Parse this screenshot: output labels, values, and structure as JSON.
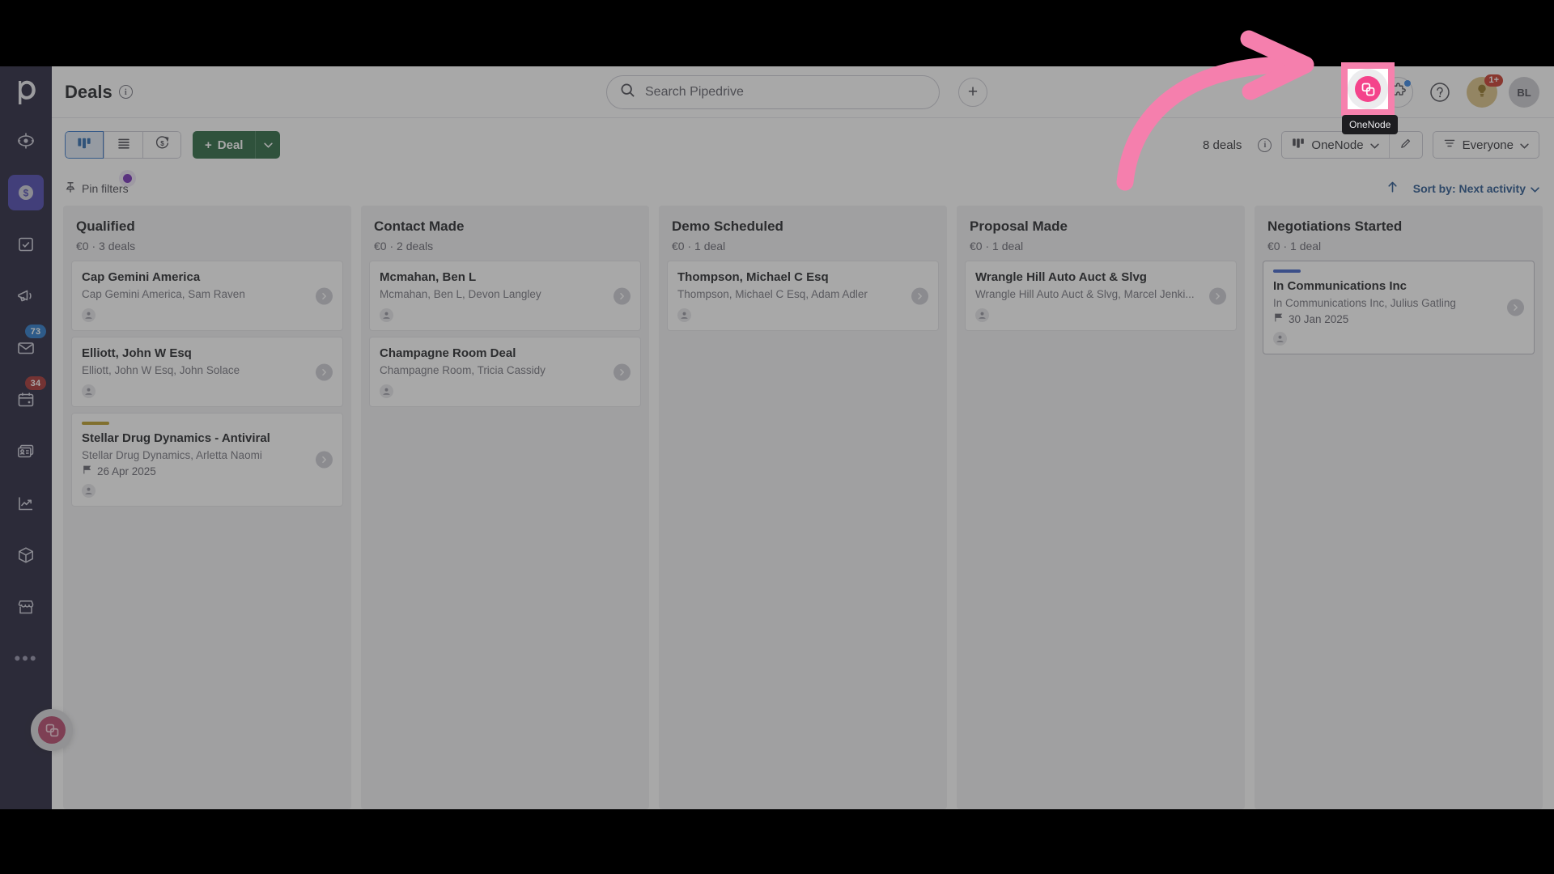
{
  "app": {
    "brand": "Pipedrive",
    "page_title": "Deals",
    "logo_icon": "pipedrive-logo-icon",
    "info_icon": "info-icon"
  },
  "sidebar": {
    "items": [
      {
        "name": "leads",
        "icon": "target-icon",
        "label": "Leads",
        "active": false,
        "badge": null
      },
      {
        "name": "deals",
        "icon": "dollar-coin-icon",
        "label": "Deals",
        "active": true,
        "badge": null
      },
      {
        "name": "activities",
        "icon": "checkbox-icon",
        "label": "Activities",
        "active": false,
        "badge": null
      },
      {
        "name": "campaigns",
        "icon": "megaphone-icon",
        "label": "Campaigns",
        "active": false,
        "badge": null
      },
      {
        "name": "mail",
        "icon": "envelope-icon",
        "label": "Mail",
        "active": false,
        "badge": "73",
        "badge_color": "#1a6fc4"
      },
      {
        "name": "calendar",
        "icon": "calendar-icon",
        "label": "Calendar",
        "active": false,
        "badge": "34",
        "badge_color": "#9e2222"
      },
      {
        "name": "contacts",
        "icon": "contact-card-icon",
        "label": "Contacts",
        "active": false,
        "badge": null
      },
      {
        "name": "insights",
        "icon": "line-chart-icon",
        "label": "Insights",
        "active": false,
        "badge": null
      },
      {
        "name": "products",
        "icon": "box-icon",
        "label": "Products",
        "active": false,
        "badge": null
      },
      {
        "name": "marketplace",
        "icon": "storefront-icon",
        "label": "Marketplace",
        "active": false,
        "badge": null
      },
      {
        "name": "more",
        "icon": "ellipsis-icon",
        "label": "More",
        "active": false,
        "badge": null
      }
    ],
    "more_glyph": "•••"
  },
  "search": {
    "placeholder": "Search Pipedrive",
    "value": "",
    "icon": "search-icon"
  },
  "topbar": {
    "add_label": "+",
    "onenode_icon": "onenode-app-icon",
    "onenode_tooltip": "OneNode",
    "apps_icon": "puzzle-piece-icon",
    "apps_has_update_dot": true,
    "help_icon": "question-mark-icon",
    "help_label": "?",
    "bulb_icon": "lightbulb-icon",
    "bulb_badge": "1+",
    "avatar_initials": "BL"
  },
  "actionbar": {
    "views": [
      {
        "name": "pipeline-view",
        "icon": "kanban-icon",
        "active": true
      },
      {
        "name": "list-view",
        "icon": "list-icon",
        "active": false
      },
      {
        "name": "forecast-view",
        "icon": "forecast-icon",
        "active": false
      }
    ],
    "deal_button": "Deal",
    "deal_button_plus": "+",
    "deal_caret_icon": "chevron-down-icon",
    "deals_count": "8 deals",
    "deals_info_icon": "info-icon",
    "pipeline_icon": "kanban-icon",
    "pipeline_name": "OneNode",
    "pipeline_caret_icon": "chevron-down-icon",
    "edit_icon": "pencil-icon",
    "filter_icon": "filter-icon",
    "filter_label": "Everyone",
    "filter_caret_icon": "chevron-down-icon"
  },
  "filterrow": {
    "pin_icon": "pin-icon",
    "pin_label": "Pin filters",
    "has_indicator_dot": true,
    "indicator_color": "#6b1fb1",
    "sort_arrow_icon": "arrow-up-icon",
    "sort_label": "Sort by: Next activity",
    "sort_caret_icon": "chevron-down-icon",
    "sort_color": "#1a4a86"
  },
  "board": {
    "columns": [
      {
        "title": "Qualified",
        "summary": "€0 · 3 deals",
        "cards": [
          {
            "title": "Cap Gemini America",
            "subtitle": "Cap Gemini America, Sam Raven",
            "date": null,
            "bar_color": null,
            "person_icon": "person-icon",
            "chevron_icon": "chevron-right-icon"
          },
          {
            "title": "Elliott, John W Esq",
            "subtitle": "Elliott, John W Esq, John Solace",
            "date": null,
            "bar_color": null,
            "person_icon": "person-icon",
            "chevron_icon": "chevron-right-icon"
          },
          {
            "title": "Stellar Drug Dynamics - Antiviral",
            "subtitle": "Stellar Drug Dynamics, Arletta Naomi",
            "date": "26 Apr 2025",
            "date_icon": "flag-icon",
            "bar_color": "#b5951a",
            "person_icon": "person-icon",
            "chevron_icon": "chevron-right-icon"
          }
        ]
      },
      {
        "title": "Contact Made",
        "summary": "€0 · 2 deals",
        "cards": [
          {
            "title": "Mcmahan, Ben L",
            "subtitle": "Mcmahan, Ben L, Devon Langley",
            "date": null,
            "bar_color": null,
            "person_icon": "person-icon",
            "chevron_icon": "chevron-right-icon"
          },
          {
            "title": "Champagne Room Deal",
            "subtitle": "Champagne Room, Tricia Cassidy",
            "date": null,
            "bar_color": null,
            "person_icon": "person-icon",
            "chevron_icon": "chevron-right-icon"
          }
        ]
      },
      {
        "title": "Demo Scheduled",
        "summary": "€0 · 1 deal",
        "cards": [
          {
            "title": "Thompson, Michael C Esq",
            "subtitle": "Thompson, Michael C Esq, Adam Adler",
            "date": null,
            "bar_color": null,
            "person_icon": "person-icon",
            "chevron_icon": "chevron-right-icon"
          }
        ]
      },
      {
        "title": "Proposal Made",
        "summary": "€0 · 1 deal",
        "cards": [
          {
            "title": "Wrangle Hill Auto Auct & Slvg",
            "subtitle": "Wrangle Hill Auto Auct & Slvg, Marcel Jenki...",
            "date": null,
            "bar_color": null,
            "person_icon": "person-icon",
            "chevron_icon": "chevron-right-icon"
          }
        ]
      },
      {
        "title": "Negotiations Started",
        "summary": "€0 · 1 deal",
        "cards": [
          {
            "title": "In Communications Inc",
            "subtitle": "In Communications Inc, Julius Gatling",
            "date": "30 Jan 2025",
            "date_icon": "flag-icon",
            "bar_color": "#3257c4",
            "person_icon": "person-icon",
            "chevron_icon": "chevron-right-icon",
            "highlighted": true
          }
        ]
      }
    ]
  },
  "widget": {
    "name": "onenode-floating-button",
    "icon": "onenode-logo-icon"
  },
  "annotation": {
    "arrow_color": "#f57fad",
    "highlight_color": "#f681ad",
    "tooltip": "OneNode"
  }
}
